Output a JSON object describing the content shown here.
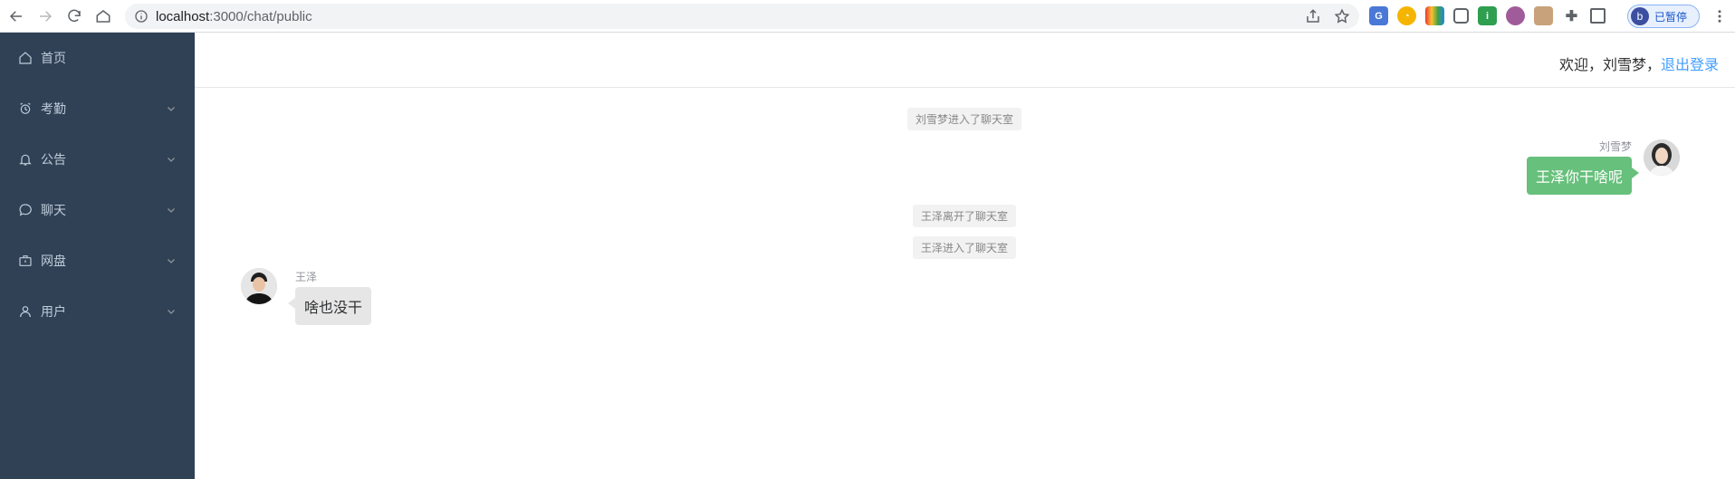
{
  "browser": {
    "url_host": "localhost",
    "url_rest": ":3000/chat/public",
    "profile_initial": "b",
    "profile_label": "已暂停"
  },
  "sidebar": {
    "items": [
      {
        "label": "首页",
        "icon": "home-icon"
      },
      {
        "label": "考勤",
        "icon": "alarm-clock-icon"
      },
      {
        "label": "公告",
        "icon": "bell-icon"
      },
      {
        "label": "聊天",
        "icon": "chat-bubble-icon"
      },
      {
        "label": "网盘",
        "icon": "briefcase-icon"
      },
      {
        "label": "用户",
        "icon": "user-icon"
      }
    ]
  },
  "header": {
    "welcome": "欢迎，刘雪梦，",
    "logout": "退出登录"
  },
  "chat": {
    "events": [
      {
        "type": "system",
        "text": "刘雪梦进入了聊天室"
      },
      {
        "type": "message",
        "side": "right",
        "name": "刘雪梦",
        "text": "王泽你干啥呢"
      },
      {
        "type": "system",
        "text": "王泽离开了聊天室"
      },
      {
        "type": "system",
        "text": "王泽进入了聊天室"
      },
      {
        "type": "message",
        "side": "left",
        "name": "王泽",
        "text": "啥也没干"
      }
    ]
  },
  "colors": {
    "sidebar_bg": "#304156",
    "link": "#409eff",
    "my_bubble": "#67c07b",
    "other_bubble": "#e6e6e6"
  }
}
